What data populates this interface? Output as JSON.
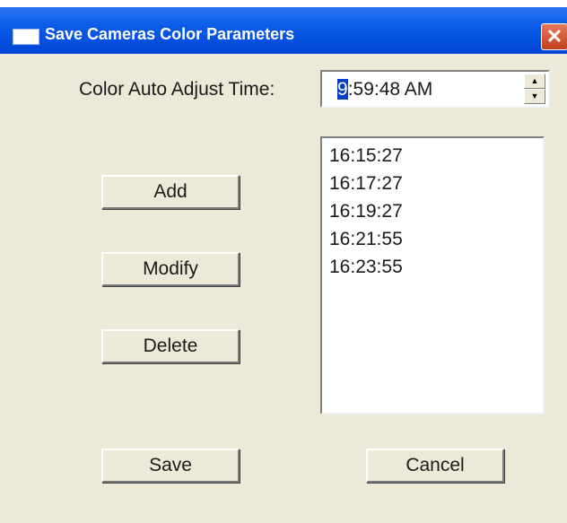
{
  "window": {
    "title": "Save Cameras Color Parameters",
    "close_glyph": "✕"
  },
  "time_field": {
    "label": "Color Auto Adjust Time:",
    "selected_part": "9",
    "rest": ":59:48 AM",
    "spin_up": "▲",
    "spin_down": "▼"
  },
  "time_list": {
    "items": [
      "16:15:27",
      "16:17:27",
      "16:19:27",
      "16:21:55",
      "16:23:55"
    ]
  },
  "buttons": {
    "add": "Add",
    "modify": "Modify",
    "delete": "Delete",
    "save": "Save",
    "cancel": "Cancel"
  }
}
